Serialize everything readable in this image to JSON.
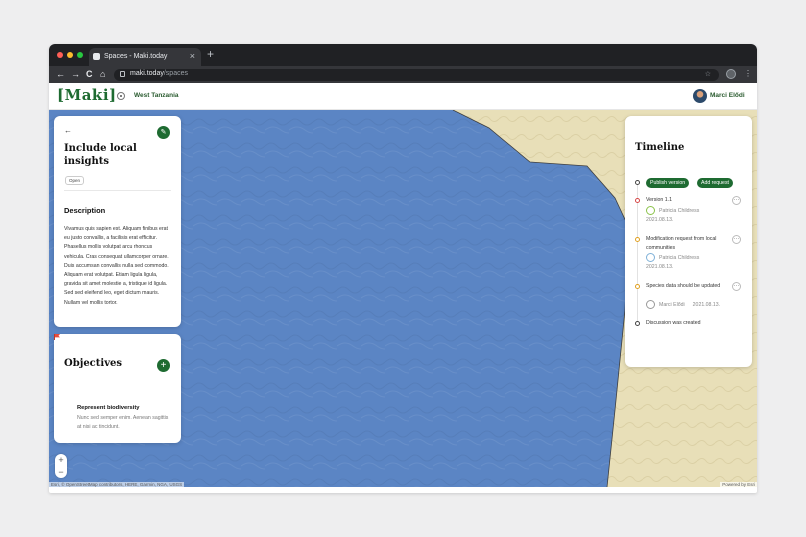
{
  "browser": {
    "tab_title": "Spaces - Maki.today",
    "close_label": "×",
    "new_tab_label": "+",
    "url_host": "maki.today",
    "url_path": "/spaces",
    "back_label": "←",
    "forward_label": "→",
    "reload_label": "C",
    "home_label": "⌂",
    "star_label": "☆",
    "menu_label": "⋮"
  },
  "header": {
    "logo": "[Maki]",
    "region": "West Tanzania",
    "user_name": "Marci Elődi"
  },
  "insight_card": {
    "back_label": "←",
    "edit_label": "✎",
    "title": "Include local insights",
    "status": "Open",
    "description_title": "Description",
    "description": "Vivamus quis sapien est. Aliquam finibus erat eu justo convallis, a facilisis erat efficitur. Phasellus mollis volutpat arcu rhoncus vehicula. Cras consequat ullamcorper ornare. Duis accumsan convallis nulla sed commodo. Aliquam erat volutpat. Etiam ligula ligula, gravida sit amet molestie a, tristique id ligula. Sed sed eleifend leo, eget dictum mauris. Nullam vel mollis tortor."
  },
  "objectives_card": {
    "title": "Objectives",
    "add_label": "+",
    "items": [
      {
        "title": "Represent biodiversity",
        "text": "Nunc sed semper enim. Aenean sagittis at nisi ac tincidunt."
      }
    ]
  },
  "timeline": {
    "title": "Timeline",
    "publish_label": "Publish version",
    "add_request_label": "Add request",
    "more_label": "···",
    "events": [
      {
        "text": "Version 1.1",
        "author": "Patricia Childress",
        "date": "2021.08.13.",
        "color": "#d64545"
      },
      {
        "text": "Modification request from local communities",
        "author": "Patricia Childress",
        "date": "2021.08.13.",
        "color": "#e0a020"
      },
      {
        "text": "Species data should be updated",
        "author": "Marci Elődi",
        "date": "2021.08.13.",
        "color": "#e0a020"
      },
      {
        "text": "Discussion was created",
        "color": "#444444"
      }
    ]
  },
  "map": {
    "zoom_in": "+",
    "zoom_out": "−",
    "attribution": "Esri, © OpenStreetMap contributors, HERE, Garmin, NGA, USGS",
    "powered_by": "Powered by Esri",
    "water_color": "#5b85c4",
    "land_color": "#e8dfb8"
  },
  "colors": {
    "brand_green": "#1e6b31"
  }
}
